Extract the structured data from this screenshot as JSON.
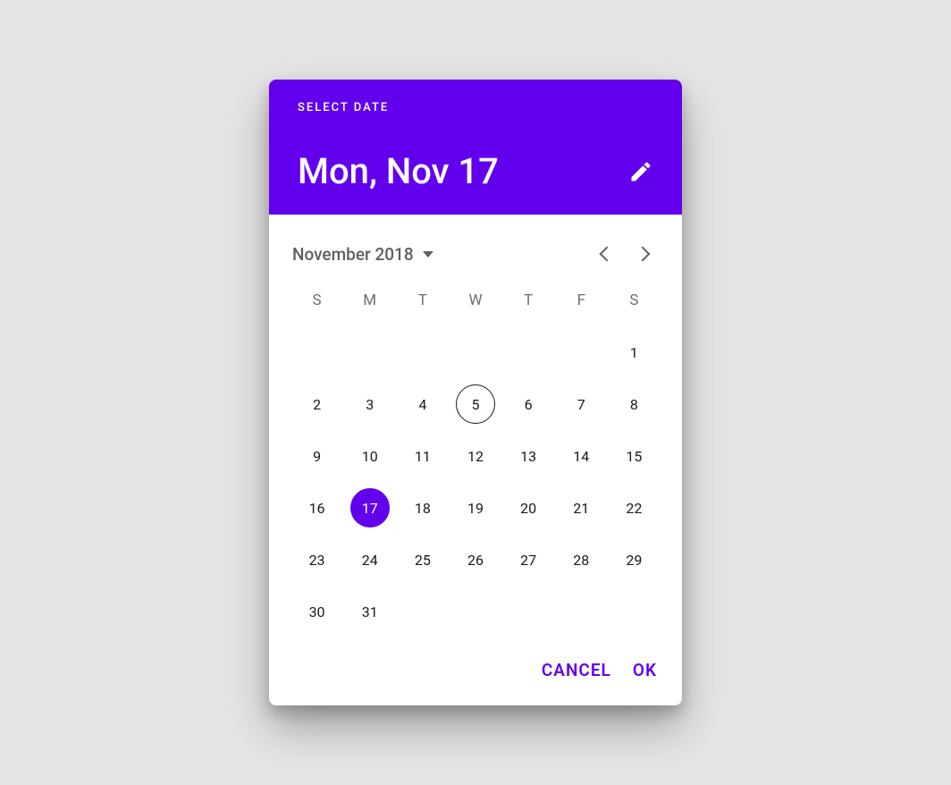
{
  "colors": {
    "accent": "#6200ee"
  },
  "header": {
    "overline": "SELECT DATE",
    "headline": "Mon, Nov 17"
  },
  "month": {
    "label": "November 2018"
  },
  "daysOfWeek": [
    "S",
    "M",
    "T",
    "W",
    "T",
    "F",
    "S"
  ],
  "calendar": {
    "leadingBlanks": 6,
    "daysInMonth": 31,
    "today": 5,
    "selected": 17
  },
  "actions": {
    "cancel": "CANCEL",
    "ok": "OK"
  }
}
